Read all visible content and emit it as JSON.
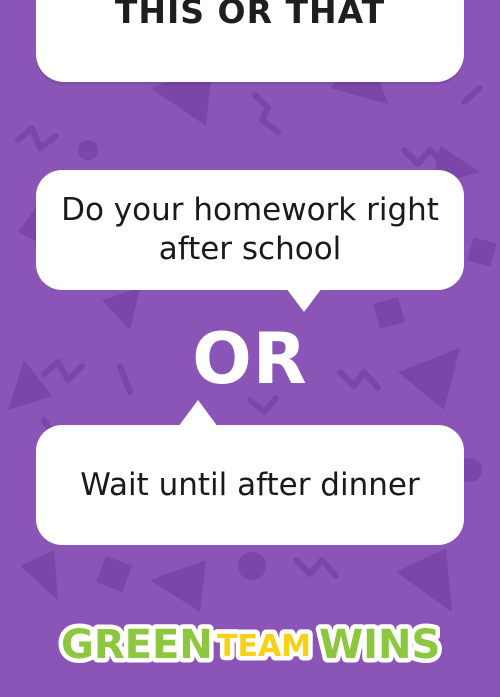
{
  "card": {
    "title": "THIS OR THAT",
    "option_a": "Do your homework right after school",
    "separator": "OR",
    "option_b": "Wait until after dinner"
  },
  "logo": {
    "word1": "GREEN",
    "word2": "TEAM",
    "word3": "WINS"
  },
  "colors": {
    "background": "#8a55b6",
    "pattern": "#7d48a9",
    "card": "#ffffff",
    "logo_green": "#8dc63f",
    "logo_yellow": "#f7d117"
  }
}
